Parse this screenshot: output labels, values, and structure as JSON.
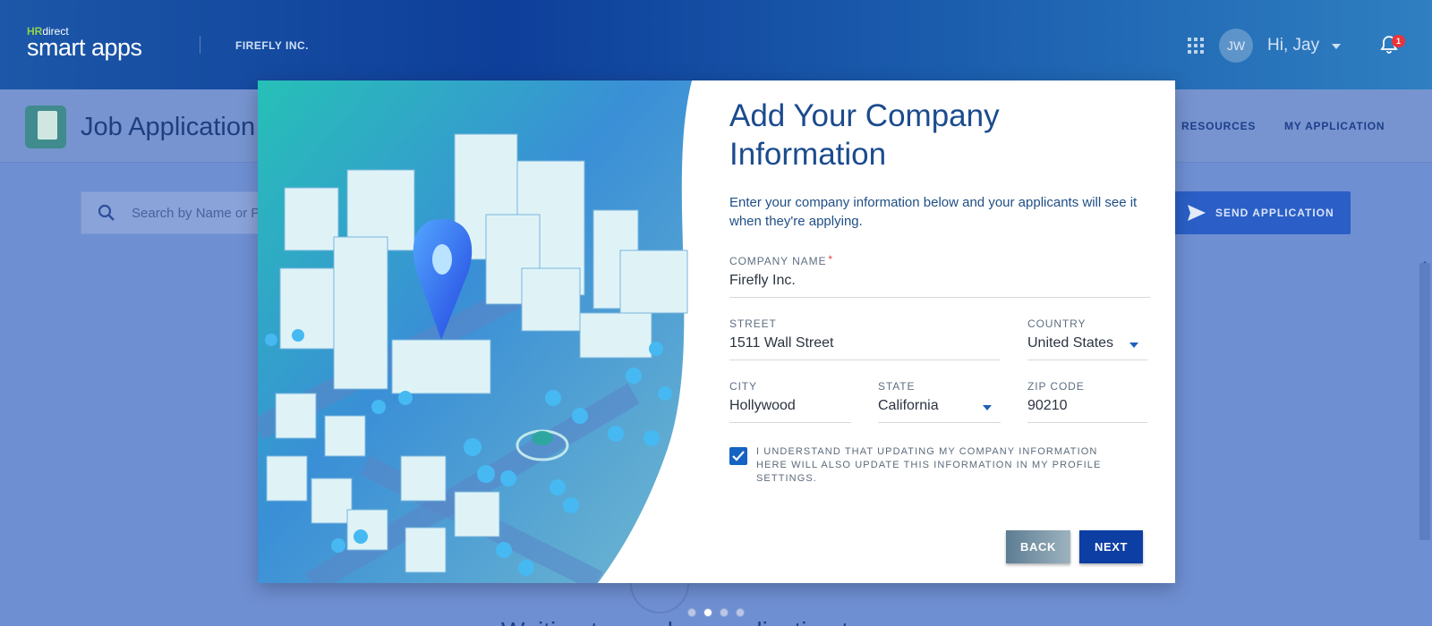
{
  "header": {
    "logo_prefix_hr": "HR",
    "logo_prefix_direct": "direct",
    "logo_name": "smart apps",
    "company": "FIREFLY INC.",
    "avatar_initials": "JW",
    "greeting": "Hi, Jay",
    "notification_count": "1"
  },
  "subheader": {
    "title": "Job Application",
    "nav": [
      "RESOURCES",
      "MY APPLICATION"
    ]
  },
  "toolbar": {
    "search_placeholder": "Search by Name or Po",
    "send_label": "SEND APPLICATION"
  },
  "modal": {
    "title": "Add Your Company Information",
    "description": "Enter your company information below and your applicants will see it when they're applying.",
    "fields": {
      "company_name": {
        "label": "COMPANY NAME",
        "required_mark": "*",
        "value": "Firefly Inc."
      },
      "street": {
        "label": "STREET",
        "value": "1511 Wall Street"
      },
      "country": {
        "label": "COUNTRY",
        "value": "United States"
      },
      "city": {
        "label": "CITY",
        "value": "Hollywood"
      },
      "state": {
        "label": "STATE",
        "value": "California"
      },
      "zip": {
        "label": "ZIP CODE",
        "value": "90210"
      }
    },
    "checkbox": {
      "checked": true,
      "label": "I UNDERSTAND THAT UPDATING MY COMPANY INFORMATION HERE WILL ALSO UPDATE THIS INFORMATION IN MY PROFILE SETTINGS."
    },
    "back_label": "BACK",
    "next_label": "NEXT"
  },
  "pagination": {
    "total": 4,
    "active_index": 1
  },
  "background_text": "Waiting to send an application to",
  "colors": {
    "primary": "#0d3ea3",
    "title_blue": "#1b4b8e",
    "badge_red": "#e8353b",
    "header_blue": "#0e3f9a"
  }
}
